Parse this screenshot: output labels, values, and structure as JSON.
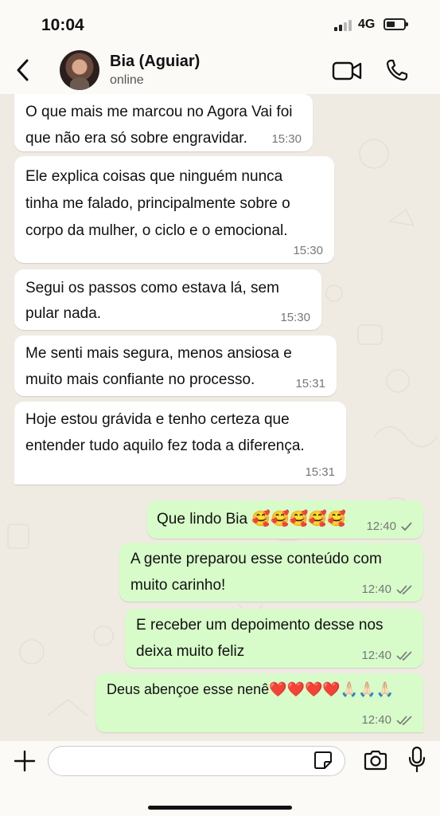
{
  "status_bar": {
    "time": "10:04",
    "network": "4G"
  },
  "header": {
    "contact_name": "Bia (Aguiar)",
    "contact_status": "online"
  },
  "messages": [
    {
      "dir": "in",
      "lines": [
        "O que mais me marcou no Agora Vai foi",
        "que não era só sobre engravidar."
      ],
      "time": "15:30"
    },
    {
      "dir": "in",
      "lines": [
        "Ele explica coisas que ninguém nunca",
        "tinha me falado, principalmente sobre o",
        "corpo da mulher, o ciclo e o emocional."
      ],
      "time": "15:30"
    },
    {
      "dir": "in",
      "lines": [
        "Segui os passos como estava lá, sem",
        "pular nada."
      ],
      "time": "15:30"
    },
    {
      "dir": "in",
      "lines": [
        "Me senti mais segura, menos ansiosa e",
        "muito mais confiante no processo."
      ],
      "time": "15:31"
    },
    {
      "dir": "in",
      "lines": [
        "Hoje estou grávida e tenho certeza que",
        "entender tudo aquilo fez toda a diferença."
      ],
      "time": "15:31"
    },
    {
      "dir": "out",
      "lines": [
        "Que lindo Bia 🥰🥰🥰🥰🥰"
      ],
      "time": "12:40",
      "ticks": "single"
    },
    {
      "dir": "out",
      "lines": [
        "A gente preparou esse conteúdo com",
        "muito carinho!"
      ],
      "time": "12:40",
      "ticks": "double"
    },
    {
      "dir": "out",
      "lines": [
        "E receber um depoimento desse nos",
        "deixa muito feliz"
      ],
      "time": "12:40",
      "ticks": "double"
    },
    {
      "dir": "out",
      "lines": [
        "Deus abençoe esse nenê❤️❤️❤️❤️🙏🏻🙏🏻🙏🏻"
      ],
      "time": "12:40",
      "ticks": "double"
    }
  ],
  "input": {
    "placeholder": ""
  },
  "colors": {
    "outgoing_bubble": "#d7fcc9",
    "incoming_bubble": "#ffffff",
    "chat_bg": "#efebe3"
  },
  "icons": [
    "back-icon",
    "video-call-icon",
    "phone-icon",
    "plus-icon",
    "sticker-icon",
    "camera-icon",
    "microphone-icon"
  ]
}
